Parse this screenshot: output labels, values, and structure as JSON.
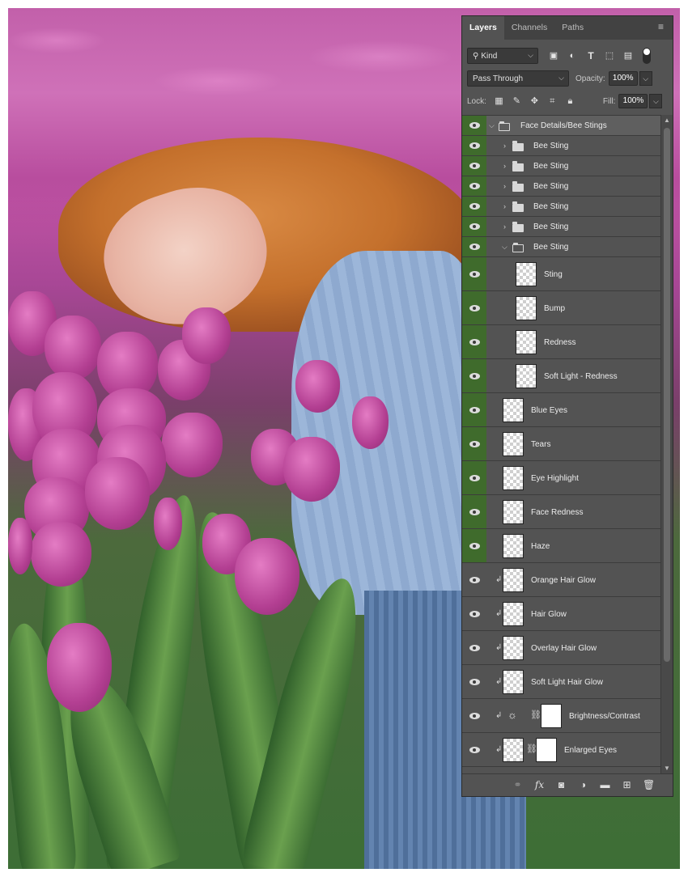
{
  "panel": {
    "tabs": [
      "Layers",
      "Channels",
      "Paths"
    ],
    "active_tab": "Layers",
    "filter_kind": "Kind",
    "blend_mode": "Pass Through",
    "opacity_label": "Opacity:",
    "opacity_value": "100%",
    "lock_label": "Lock:",
    "fill_label": "Fill:",
    "fill_value": "100%"
  },
  "layers": [
    {
      "name": "Face Details/Bee Stings",
      "type": "group",
      "open": true
    },
    {
      "name": "Bee Sting",
      "type": "group",
      "open": false
    },
    {
      "name": "Bee Sting",
      "type": "group",
      "open": false
    },
    {
      "name": "Bee Sting",
      "type": "group",
      "open": false
    },
    {
      "name": "Bee Sting",
      "type": "group",
      "open": false
    },
    {
      "name": "Bee Sting",
      "type": "group",
      "open": false
    },
    {
      "name": "Bee Sting",
      "type": "group",
      "open": true
    },
    {
      "name": "Sting",
      "type": "layer"
    },
    {
      "name": "Bump",
      "type": "layer"
    },
    {
      "name": "Redness",
      "type": "layer"
    },
    {
      "name": "Soft Light - Redness",
      "type": "layer"
    },
    {
      "name": "Blue Eyes",
      "type": "layer"
    },
    {
      "name": "Tears",
      "type": "layer"
    },
    {
      "name": "Eye Highlight",
      "type": "layer"
    },
    {
      "name": "Face Redness",
      "type": "layer"
    },
    {
      "name": "Haze",
      "type": "layer"
    },
    {
      "name": "Orange Hair Glow",
      "type": "clipped"
    },
    {
      "name": "Hair Glow",
      "type": "clipped"
    },
    {
      "name": "Overlay Hair Glow",
      "type": "clipped"
    },
    {
      "name": "Soft Light  Hair Glow",
      "type": "clipped"
    },
    {
      "name": "Brightness/Contrast",
      "type": "adjustment"
    },
    {
      "name": "Enlarged Eyes",
      "type": "masked"
    }
  ],
  "colors": {
    "panel_bg": "#535353",
    "visibility_highlight": "#3f6b2c",
    "tab_bar": "#424242"
  },
  "icons": {
    "footer": [
      "link-icon",
      "fx-icon",
      "mask-icon",
      "adjustment-icon",
      "new-group-icon",
      "new-layer-icon",
      "trash-icon"
    ]
  }
}
